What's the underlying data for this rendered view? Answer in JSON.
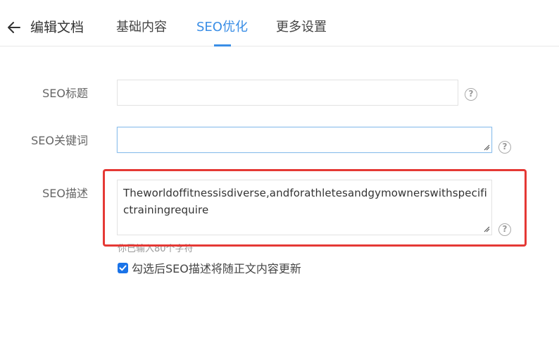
{
  "header": {
    "back_icon": "arrow-left-icon",
    "title": "编辑文档",
    "tabs": [
      {
        "label": "基础内容",
        "active": false
      },
      {
        "label": "SEO优化",
        "active": true
      },
      {
        "label": "更多设置",
        "active": false
      }
    ],
    "accent_color": "#3a8ee6"
  },
  "form": {
    "seo_title": {
      "label": "SEO标题",
      "value": ""
    },
    "seo_keywords": {
      "label": "SEO关键词",
      "value": ""
    },
    "seo_description": {
      "label": "SEO描述",
      "value": "Theworldoffitnessisdiverse,andforathletesandgymownerswithspecifictrainingrequire"
    },
    "counter_text": "你已输入80个字符",
    "auto_update": {
      "label": "勾选后SEO描述将随正文内容更新",
      "checked": true
    },
    "help_icon": "question-circle-icon",
    "highlight_color": "#e53935"
  }
}
